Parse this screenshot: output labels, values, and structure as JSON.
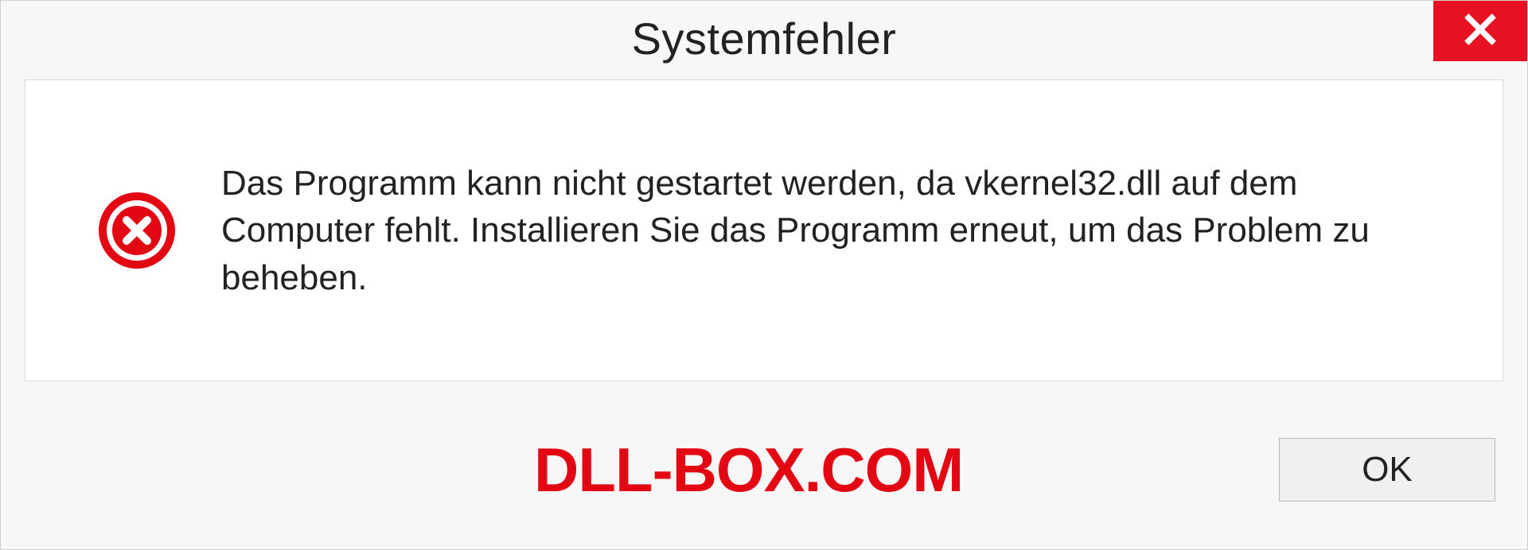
{
  "dialog": {
    "title": "Systemfehler",
    "message": "Das Programm kann nicht gestartet werden, da vkernel32.dll auf dem Computer fehlt. Installieren Sie das Programm erneut, um das Problem zu beheben.",
    "ok_label": "OK"
  },
  "watermark": "DLL-BOX.COM"
}
